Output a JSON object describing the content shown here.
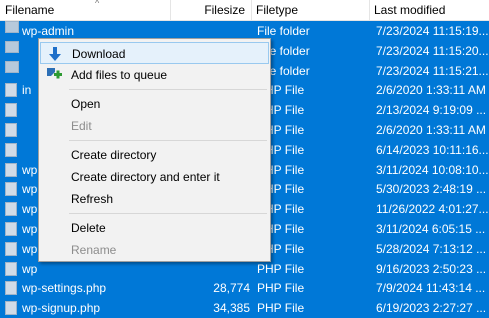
{
  "header": {
    "filename": "Filename",
    "filesize": "Filesize",
    "filetype": "Filetype",
    "last_modified": "Last modified"
  },
  "rows": [
    {
      "name": "wp-admin",
      "size": "",
      "type": "File folder",
      "modified": "7/23/2024 11:15:19..."
    },
    {
      "name": "",
      "size": "",
      "type": "File folder",
      "modified": "7/23/2024 11:15:20..."
    },
    {
      "name": "",
      "size": "",
      "type": "File folder",
      "modified": "7/23/2024 11:15:21..."
    },
    {
      "name": "in",
      "size": "",
      "type": "PHP File",
      "modified": "2/6/2020 1:33:11 AM"
    },
    {
      "name": "",
      "size": "",
      "type": "PHP File",
      "modified": "2/13/2024 9:19:09 ..."
    },
    {
      "name": "",
      "size": "",
      "type": "PHP File",
      "modified": "2/6/2020 1:33:11 AM"
    },
    {
      "name": "",
      "size": "",
      "type": "PHP File",
      "modified": "6/14/2023 10:11:16..."
    },
    {
      "name": "wp",
      "size": "",
      "type": "PHP File",
      "modified": "3/11/2024 10:08:10..."
    },
    {
      "name": "wp",
      "size": "",
      "type": "PHP File",
      "modified": "5/30/2023 2:48:19 ..."
    },
    {
      "name": "wp",
      "size": "",
      "type": "PHP File",
      "modified": "11/26/2022 4:01:27..."
    },
    {
      "name": "wp",
      "size": "",
      "type": "PHP File",
      "modified": "3/11/2024 6:05:15 ..."
    },
    {
      "name": "wp",
      "size": "",
      "type": "PHP File",
      "modified": "5/28/2024 7:13:12 ..."
    },
    {
      "name": "wp",
      "size": "",
      "type": "PHP File",
      "modified": "9/16/2023 2:50:23 ..."
    },
    {
      "name": "wp-settings.php",
      "size": "28,774",
      "type": "PHP File",
      "modified": "7/9/2024 11:43:14 ..."
    },
    {
      "name": "wp-signup.php",
      "size": "34,385",
      "type": "PHP File",
      "modified": "6/19/2023 2:27:27 ..."
    }
  ],
  "menu": {
    "download": "Download",
    "add_to_queue": "Add files to queue",
    "open": "Open",
    "edit": "Edit",
    "create_directory": "Create directory",
    "create_directory_enter": "Create directory and enter it",
    "refresh": "Refresh",
    "delete": "Delete",
    "rename": "Rename"
  },
  "colors": {
    "selection": "#0078d7",
    "menu_bg": "#f2f2f2",
    "menu_hover": "#e5f1fb",
    "disabled_text": "#8d8d8d"
  },
  "icons": {
    "download": "download-arrow-icon",
    "add_to_queue": "add-to-queue-icon",
    "folder": "folder-icon",
    "php": "php-file-icon"
  }
}
